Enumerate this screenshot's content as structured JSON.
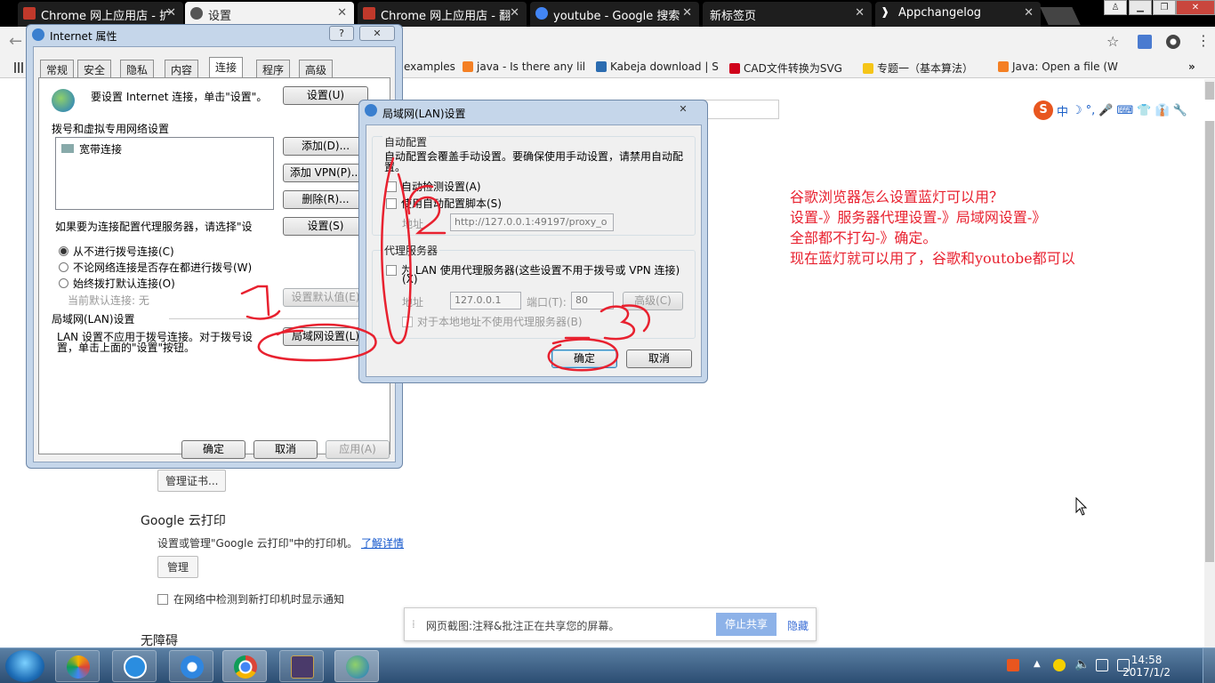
{
  "browser": {
    "tabs": [
      {
        "label": "Chrome 网上应用店 - 扩",
        "active": false
      },
      {
        "label": "设置",
        "active": true
      },
      {
        "label": "Chrome 网上应用店 - 翻",
        "active": false
      },
      {
        "label": "youtube - Google 搜索",
        "active": false
      },
      {
        "label": "新标签页",
        "active": false
      },
      {
        "label": "Appchangelog",
        "active": false
      }
    ],
    "bookmarks": [
      {
        "label": "examples",
        "color": "#fff"
      },
      {
        "label": "java - Is there any lil",
        "color": "#f48024"
      },
      {
        "label": "Kabeja download | S",
        "color": "#2b6cb0"
      },
      {
        "label": "CAD文件转换为SVG",
        "color": "#d0021b"
      },
      {
        "label": "专题一（基本算法）",
        "color": "#f5c518"
      },
      {
        "label": "Java: Open a file (W",
        "color": "#f48024"
      }
    ],
    "bookmarks_more": "»"
  },
  "ime": {
    "logo": "S",
    "mode": "中",
    "items": [
      "☽",
      "°,",
      "🎤",
      "⌨",
      "👕",
      "👔",
      "🔧"
    ]
  },
  "annotation_note": {
    "lines": [
      "谷歌浏览器怎么设置蓝灯可以用？",
      "设置-》服务器代理设置-》局域网设置-》",
      "全部都不打勾-》确定。",
      "现在蓝灯就可以用了，谷歌和youtobe都可以"
    ]
  },
  "settings_page": {
    "manage_certs_button": "管理证书...",
    "cloud_print_heading": "Google 云打印",
    "cloud_print_desc": "设置或管理\"Google 云打印\"中的打印机。",
    "learn_more_link": "了解详情",
    "manage_button": "管理",
    "notify_checkbox_label": "在网络中检测到新打印机时显示通知",
    "accessibility_heading": "无障碍"
  },
  "share_bar": {
    "text": "网页截图:注释&批注正在共享您的屏幕。",
    "stop_button": "停止共享",
    "hide_link": "隐藏"
  },
  "internet_properties": {
    "title": "Internet 属性",
    "tabs": [
      "常规",
      "安全",
      "隐私",
      "内容",
      "连接",
      "程序",
      "高级"
    ],
    "active_tab": "连接",
    "setup_text": "要设置 Internet 连接，单击\"设置\"。",
    "setup_button": "设置(U)",
    "dialup_heading": "拨号和虚拟专用网络设置",
    "connections": [
      "宽带连接"
    ],
    "add_button": "添加(D)...",
    "add_vpn_button": "添加 VPN(P)...",
    "remove_button": "删除(R)...",
    "proxy_prompt": "如果要为连接配置代理服务器，请选择\"设",
    "settings_button": "设置(S)",
    "radios": [
      {
        "label": "从不进行拨号连接(C)",
        "selected": true
      },
      {
        "label": "不论网络连接是否存在都进行拨号(W)",
        "selected": false
      },
      {
        "label": "始终拨打默认连接(O)",
        "selected": false
      }
    ],
    "current_default_label": "当前默认连接:",
    "current_default_value": "无",
    "set_default_button": "设置默认值(E)",
    "lan_heading": "局域网(LAN)设置",
    "lan_text_1": "LAN 设置不应用于拨号连接。对于拨号设",
    "lan_text_2": "置，单击上面的\"设置\"按钮。",
    "lan_button": "局域网设置(L)",
    "ok_button": "确定",
    "cancel_button": "取消",
    "apply_button": "应用(A)",
    "help_glyph": "?",
    "close_glyph": "✕"
  },
  "lan_settings": {
    "title": "局域网(LAN)设置",
    "auto_config_heading": "自动配置",
    "auto_config_desc_1": "自动配置会覆盖手动设置。要确保使用手动设置，请禁用自动配",
    "auto_config_desc_2": "置。",
    "auto_detect_label": "自动检测设置(A)",
    "auto_detect_checked": false,
    "use_script_label": "使用自动配置脚本(S)",
    "use_script_checked": false,
    "address_label": "地址",
    "script_address": "http://127.0.0.1:49197/proxy_o",
    "proxy_heading": "代理服务器",
    "use_proxy_label": "为 LAN 使用代理服务器(这些设置不用于拨号或 VPN 连接)",
    "use_proxy_label_2": "(X)",
    "use_proxy_checked": false,
    "proxy_address_label": "地址",
    "proxy_address": "127.0.0.1",
    "port_label": "端口(T):",
    "port_value": "80",
    "advanced_button": "高级(C)",
    "bypass_label": "对于本地地址不使用代理服务器(B)",
    "ok_button": "确定",
    "cancel_button": "取消",
    "close_glyph": "✕"
  },
  "annotations": {
    "step1": "1",
    "step2": "2",
    "step3": "3",
    "color": "#e8212f"
  },
  "taskbar": {
    "apps": [
      "pinwheel-app",
      "sogou-app",
      "baidu-cloud-app",
      "chrome-app",
      "java-ee-ide-app",
      "internet-options-app"
    ],
    "time": "14:58",
    "date": "2017/1/2"
  }
}
